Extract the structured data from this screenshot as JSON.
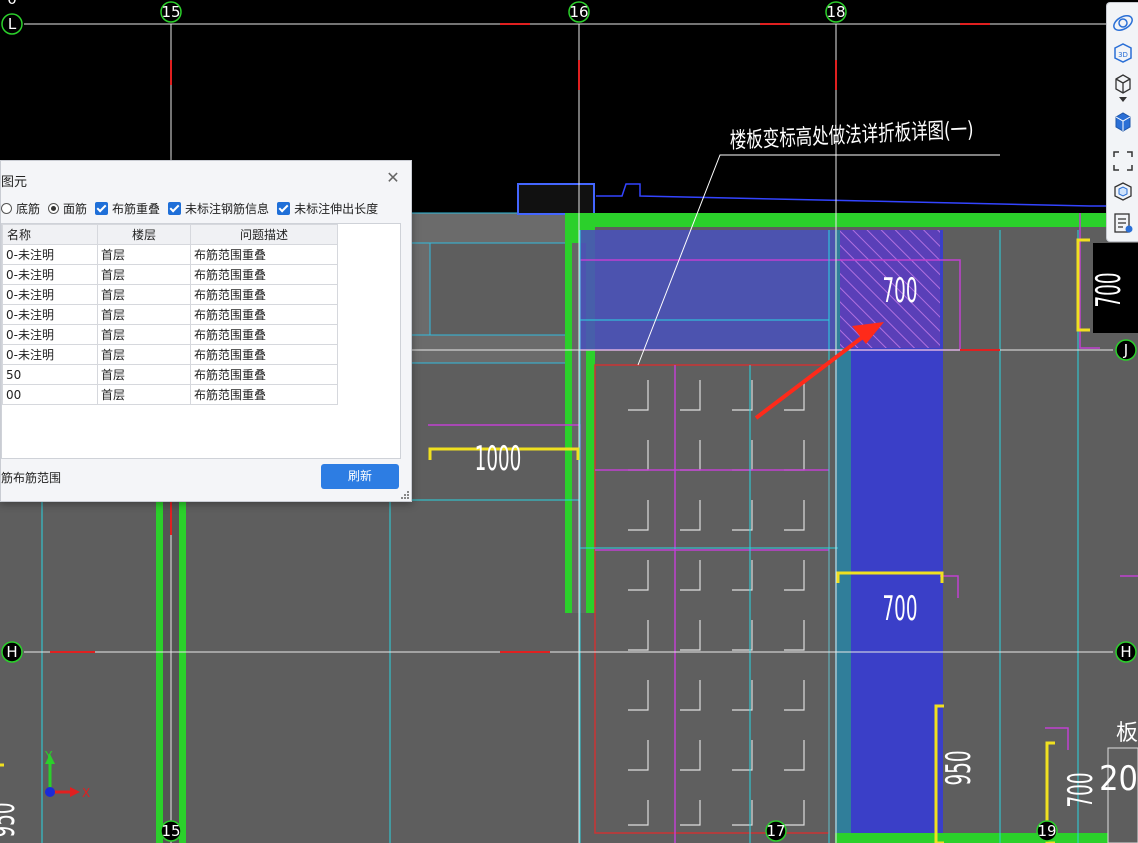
{
  "axis_labels": {
    "top_left": "L",
    "top_15": "15",
    "top_16": "16",
    "top_18": "18",
    "left_H": "H",
    "right_J": "J",
    "right_H": "H",
    "bottom_15": "15",
    "bottom_17": "17",
    "bottom_19": "19",
    "corner_zero": "0"
  },
  "dimensions": {
    "dim_1000": "1000",
    "dim_700_top": "700",
    "dim_700_mid": "700",
    "dim_700_right": "700",
    "dim_950": "950",
    "dim_700_bottom": "700",
    "dim_20_partial": "20",
    "partial_left": "950"
  },
  "annotation": {
    "note": "楼板变标高处做法详折板详图(一)",
    "partial_right": "板底"
  },
  "coord_icon": {
    "y": "Y",
    "x": "X"
  },
  "dialog": {
    "title": "图元",
    "close": "✕",
    "options": [
      {
        "type": "radio",
        "checked": false,
        "label": "底筋"
      },
      {
        "type": "radio",
        "checked": true,
        "label": "面筋"
      },
      {
        "type": "checkbox",
        "checked": true,
        "label": "布筋重叠"
      },
      {
        "type": "checkbox",
        "checked": true,
        "label": "未标注钢筋信息"
      },
      {
        "type": "checkbox",
        "checked": true,
        "label": "未标注伸出长度"
      }
    ],
    "columns": [
      "名称",
      "楼层",
      "问题描述"
    ],
    "rows": [
      [
        "0-未注明",
        "首层",
        "布筋范围重叠"
      ],
      [
        "0-未注明",
        "首层",
        "布筋范围重叠"
      ],
      [
        "0-未注明",
        "首层",
        "布筋范围重叠"
      ],
      [
        "0-未注明",
        "首层",
        "布筋范围重叠"
      ],
      [
        "0-未注明",
        "首层",
        "布筋范围重叠"
      ],
      [
        "0-未注明",
        "首层",
        "布筋范围重叠"
      ],
      [
        "50",
        "首层",
        "布筋范围重叠"
      ],
      [
        "00",
        "首层",
        "布筋范围重叠"
      ]
    ],
    "footer_label": "筋布筋范围",
    "refresh_label": "刷新"
  },
  "toolbar": {
    "buttons": [
      "orbit-icon",
      "3d-view-icon",
      "cube-view-icon",
      "view-dropdown-icon",
      "solid-cube-icon",
      "fit-window-icon",
      "cube-nav-icon",
      "properties-icon"
    ],
    "label_3d": "3D"
  }
}
